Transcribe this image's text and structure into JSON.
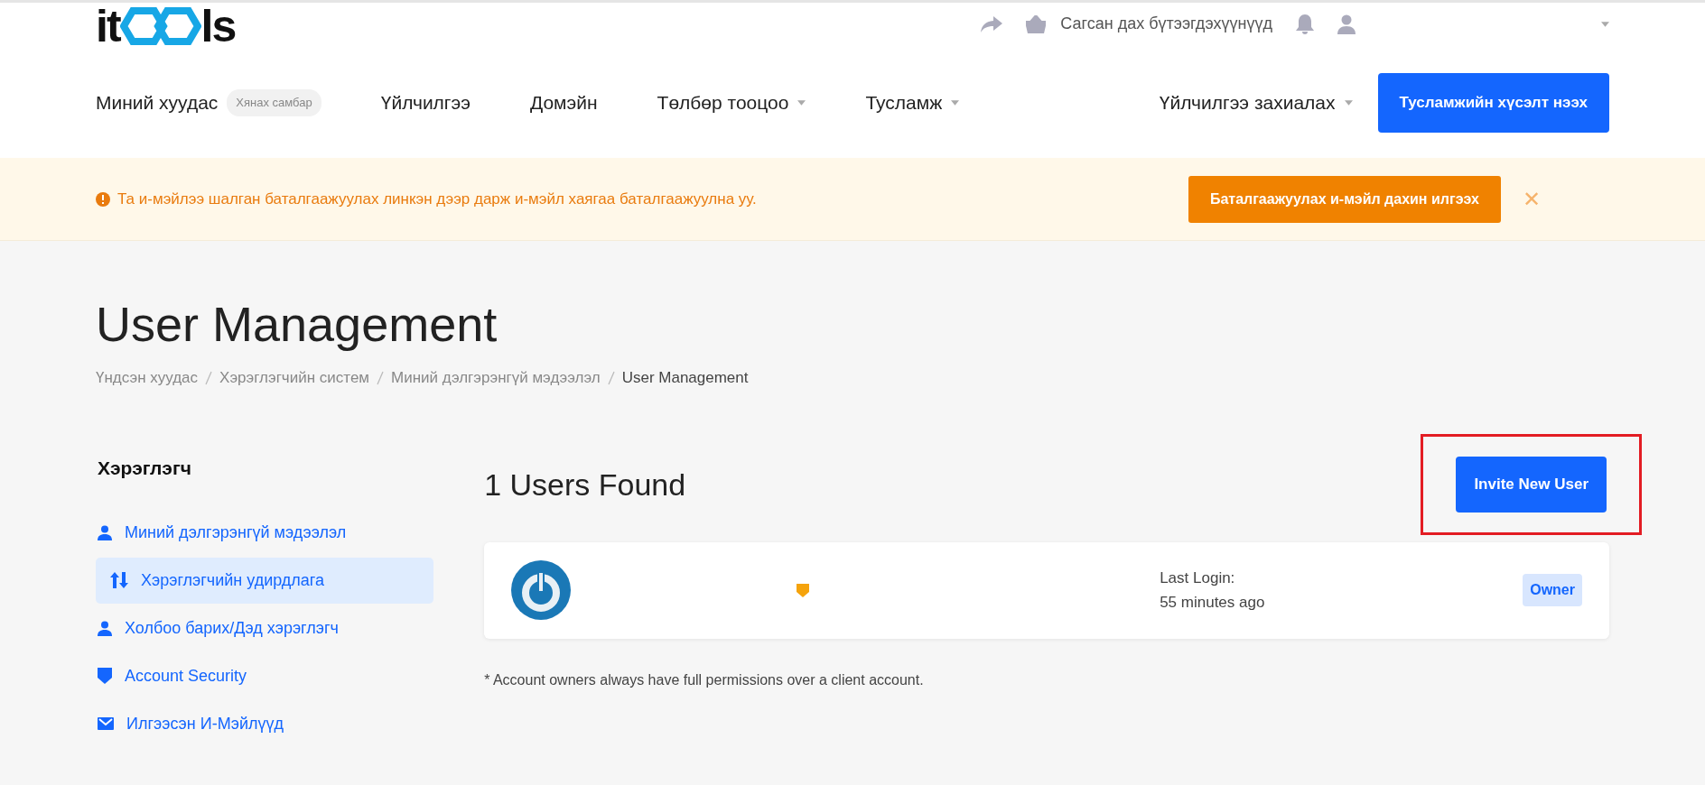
{
  "logo": {
    "left": "it",
    "right": "ls"
  },
  "top_bar": {
    "cart_label": "Сагсан дах бүтээгдэхүүнүүд"
  },
  "nav": [
    {
      "label": "Миний хуудас",
      "badge": "Хянах самбар",
      "dropdown": false
    },
    {
      "label": "Үйлчилгээ",
      "dropdown": false
    },
    {
      "label": "Домэйн",
      "dropdown": false
    },
    {
      "label": "Төлбөр тооцоо",
      "dropdown": true
    },
    {
      "label": "Тусламж",
      "dropdown": true
    }
  ],
  "nav_right": {
    "label": "Үйлчилгээ захиалах",
    "dropdown": true,
    "button": "Тусламжийн хүсэлт нээх"
  },
  "alert": {
    "message": "Та и-мэйлээ шалган баталгаажуулах линкэн дээр дарж и-мэйл хаягаа баталгаажуулна уу.",
    "button": "Баталгаажуулах и-мэйл дахин илгээх",
    "close": "✕"
  },
  "page_title": "User Management",
  "breadcrumb": [
    "Үндсэн хуудас",
    "Хэрэглэгчийн систем",
    "Миний дэлгэрэнгүй мэдээлэл",
    "User Management"
  ],
  "sidebar": {
    "heading": "Хэрэглэгч",
    "items": [
      {
        "label": "Миний дэлгэрэнгүй мэдээлэл",
        "kind": "user",
        "selected": false
      },
      {
        "label": "Хэрэглэгчийн удирдлага",
        "kind": "manage",
        "selected": true
      },
      {
        "label": "Холбоо барих/Дэд хэрэглэгч",
        "kind": "user",
        "selected": false
      },
      {
        "label": "Account Security",
        "kind": "security",
        "selected": false
      },
      {
        "label": "Илгээсэн И-Мэйлүүд",
        "kind": "mail",
        "selected": false
      }
    ]
  },
  "users_found": "1 Users Found",
  "invite_button": {
    "label": "Invite New User",
    "highlighted": true
  },
  "users": [
    {
      "last_login_label": "Last Login:",
      "last_login": "55 minutes ago",
      "role": "Owner"
    }
  ],
  "footnote": "* Account owners always have full permissions over a client account."
}
